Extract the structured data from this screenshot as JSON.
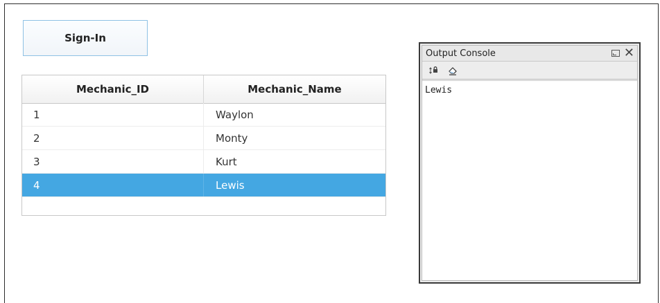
{
  "signin": {
    "label": "Sign-In"
  },
  "table": {
    "columns": [
      "Mechanic_ID",
      "Mechanic_Name"
    ],
    "rows": [
      {
        "id": "1",
        "name": "Waylon"
      },
      {
        "id": "2",
        "name": "Monty"
      },
      {
        "id": "3",
        "name": "Kurt"
      },
      {
        "id": "4",
        "name": "Lewis"
      }
    ],
    "selected_row": 4
  },
  "console": {
    "title": "Output Console",
    "output": "Lewis",
    "icons": [
      "restore-icon",
      "close-icon",
      "scroll-lock-icon",
      "clear-eraser-icon"
    ]
  },
  "colors": {
    "selection": "#44a7e2",
    "button_border": "#8ec1e4"
  }
}
